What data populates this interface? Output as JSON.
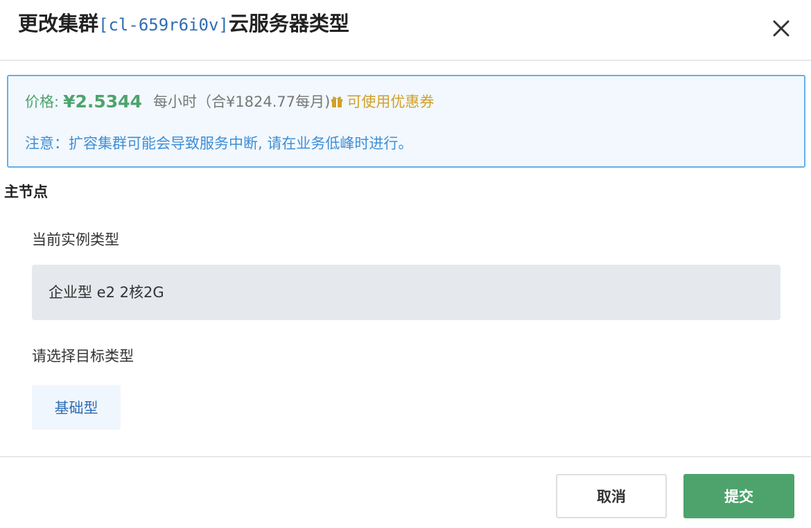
{
  "dialog": {
    "title_prefix": "更改集群",
    "cluster_id": "[cl-659r6i0v]",
    "title_suffix": "云服务器类型"
  },
  "notice": {
    "price_label": "价格:",
    "price_value": "¥2.5344",
    "price_unit": "每小时（合¥1824.77每月)",
    "coupon_text": "可使用优惠券",
    "warning": "注意：扩容集群可能会导致服务中断, 请在业务低峰时进行。"
  },
  "section": {
    "title": "主节点",
    "current_label": "当前实例类型",
    "current_value": "企业型 e2 2核2G",
    "target_label": "请选择目标类型",
    "target_options": [
      "基础型"
    ]
  },
  "footer": {
    "cancel_label": "取消",
    "submit_label": "提交"
  },
  "icons": {
    "close": "close-icon",
    "coupon": "gift-icon"
  },
  "colors": {
    "price_green": "#4ea36d",
    "notice_blue": "#3f8ed6",
    "coupon_gold": "#d3a02a",
    "primary_button": "#4ea36d"
  }
}
